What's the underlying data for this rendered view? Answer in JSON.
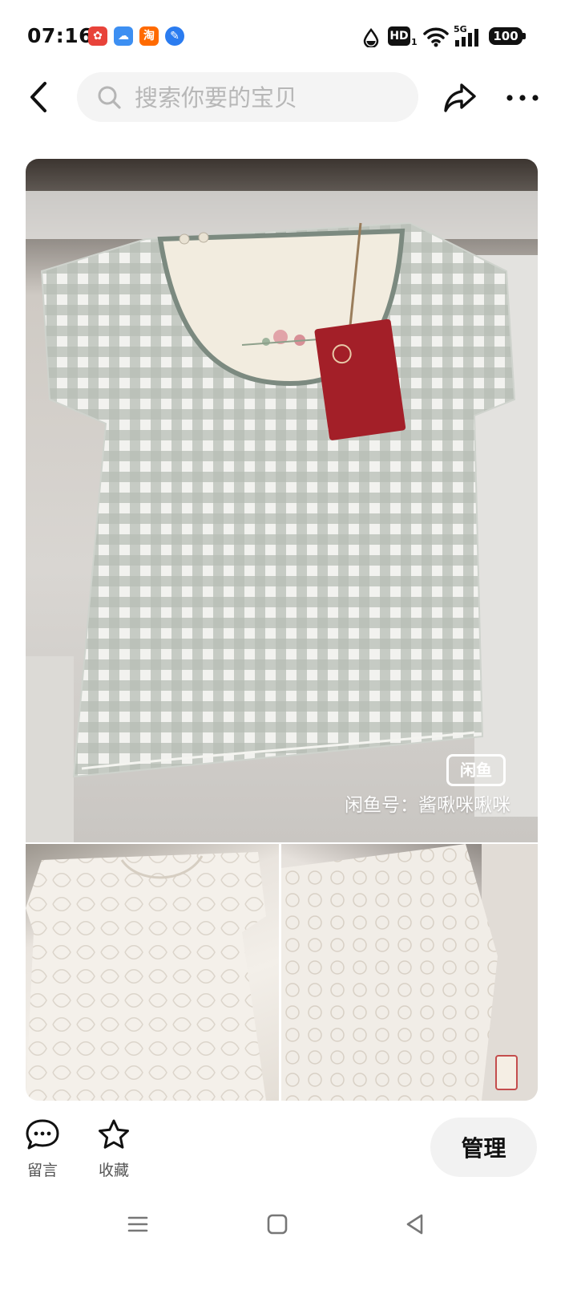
{
  "status_bar": {
    "time": "07:16",
    "app_icons": [
      "taobao-special-icon",
      "weather-icon",
      "taobao-icon",
      "feather-icon"
    ],
    "app_icon_3_label": "淘",
    "indicators": [
      "drop-icon",
      "hd-icon",
      "wifi-icon",
      "5g-signal-icon"
    ],
    "hd_label": "HD",
    "hd_sub": "1",
    "network_label": "5G",
    "battery": "100"
  },
  "header": {
    "search_placeholder": "搜索你要的宝贝",
    "icons": [
      "back-icon",
      "search-icon",
      "share-icon",
      "more-icon"
    ]
  },
  "gallery": {
    "watermark_logo": "闲鱼",
    "watermark_text": "闲鱼号：酱啾咪啾咪",
    "colors": {
      "gingham": "#aeb5ad",
      "collar": "#f2ecdf",
      "tag": "#a31f28",
      "lace": "#f4f0ea"
    }
  },
  "actions": {
    "comment_label": "留言",
    "favorite_label": "收藏",
    "manage_label": "管理"
  },
  "nav": {
    "icons": [
      "menu-icon",
      "home-icon",
      "back-nav-icon"
    ]
  }
}
